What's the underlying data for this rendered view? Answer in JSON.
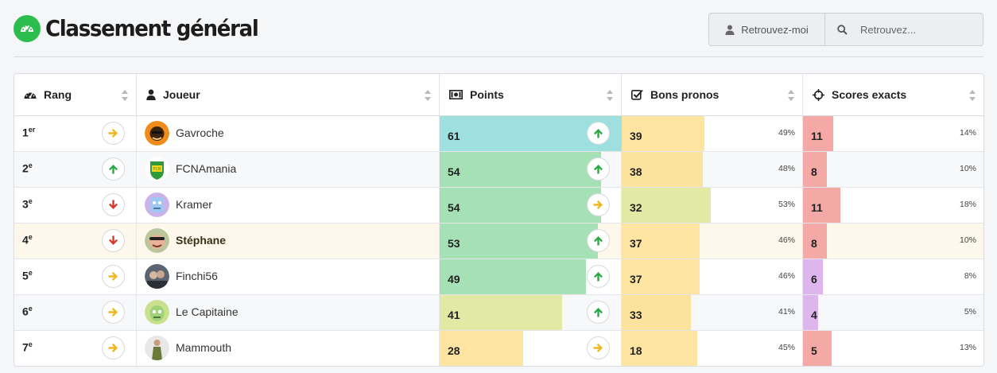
{
  "page": {
    "title": "Classement général"
  },
  "toolbar": {
    "findme_label": "Retrouvez-moi",
    "search_placeholder": "Retrouvez..."
  },
  "columns": {
    "rank": "Rang",
    "player": "Joueur",
    "points": "Points",
    "good": "Bons pronos",
    "exact": "Scores exacts"
  },
  "colors": {
    "brand": "#2bbd4e",
    "up": "#2aa845",
    "right": "#f1b619",
    "down": "#d33a2c"
  },
  "rows": [
    {
      "rank": "1",
      "suffix": "er",
      "trend": "right",
      "player": "Gavroche",
      "points": "61",
      "points_fill": 1.0,
      "points_color": "#9de0df",
      "points_trend": "up",
      "good": "39",
      "good_pct": "49%",
      "good_fill": 0.49,
      "good_color": "#fde4a0",
      "exact": "11",
      "exact_pct": "14%",
      "exact_fill": 0.14,
      "exact_color": "#f4a9a7"
    },
    {
      "rank": "2",
      "suffix": "e",
      "trend": "up",
      "player": "FCNAmania",
      "points": "54",
      "points_fill": 0.885,
      "points_color": "#a6e1b5",
      "points_trend": "up",
      "good": "38",
      "good_pct": "48%",
      "good_fill": 0.48,
      "good_color": "#fbe29d",
      "exact": "8",
      "exact_pct": "10%",
      "exact_fill": 0.1,
      "exact_color": "#f4a9a7"
    },
    {
      "rank": "3",
      "suffix": "e",
      "trend": "down",
      "player": "Kramer",
      "points": "54",
      "points_fill": 0.885,
      "points_color": "#a6e1b5",
      "points_trend": "right",
      "good": "32",
      "good_pct": "53%",
      "good_fill": 0.53,
      "good_color": "#e2e9a4",
      "exact": "11",
      "exact_pct": "18%",
      "exact_fill": 0.18,
      "exact_color": "#f4a9a7"
    },
    {
      "rank": "4",
      "suffix": "e",
      "trend": "down",
      "player": "Stéphane",
      "me": true,
      "points": "53",
      "points_fill": 0.869,
      "points_color": "#a6e1b5",
      "points_trend": "up",
      "good": "37",
      "good_pct": "46%",
      "good_fill": 0.46,
      "good_color": "#fde4a0",
      "exact": "8",
      "exact_pct": "10%",
      "exact_fill": 0.1,
      "exact_color": "#f4a9a7"
    },
    {
      "rank": "5",
      "suffix": "e",
      "trend": "right",
      "player": "Finchi56",
      "points": "49",
      "points_fill": 0.803,
      "points_color": "#a6e1b5",
      "points_trend": "up",
      "good": "37",
      "good_pct": "46%",
      "good_fill": 0.46,
      "good_color": "#fde4a0",
      "exact": "6",
      "exact_pct": "8%",
      "exact_fill": 0.08,
      "exact_color": "#dcb6ec"
    },
    {
      "rank": "6",
      "suffix": "e",
      "trend": "right",
      "player": "Le Capitaine",
      "points": "41",
      "points_fill": 0.672,
      "points_color": "#e2e9a4",
      "points_trend": "up",
      "good": "33",
      "good_pct": "41%",
      "good_fill": 0.41,
      "good_color": "#fbe29d",
      "exact": "4",
      "exact_pct": "5%",
      "exact_fill": 0.05,
      "exact_color": "#dcb6ec"
    },
    {
      "rank": "7",
      "suffix": "e",
      "trend": "right",
      "player": "Mammouth",
      "points": "28",
      "points_fill": 0.459,
      "points_color": "#fde4a0",
      "points_trend": "right",
      "good": "18",
      "good_pct": "45%",
      "good_fill": 0.45,
      "good_color": "#fde4a0",
      "exact": "5",
      "exact_pct": "13%",
      "exact_fill": 0.13,
      "exact_color": "#f4a9a7"
    }
  ]
}
